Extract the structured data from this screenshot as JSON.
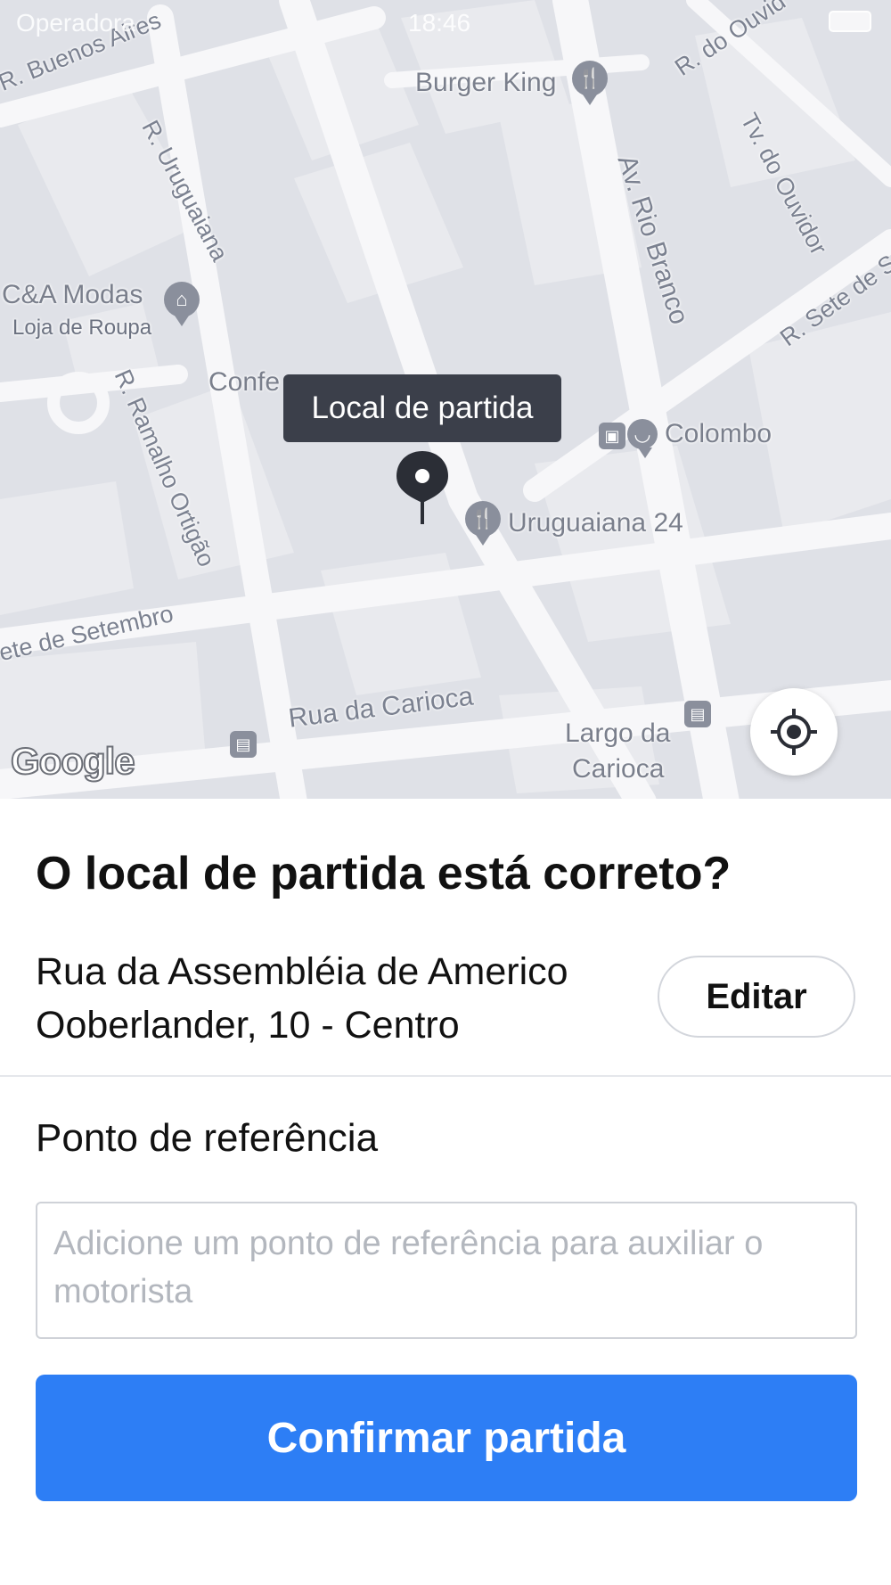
{
  "status_bar": {
    "carrier": "Operadora",
    "time": "18:46"
  },
  "map": {
    "streets": {
      "buenos_aires": "R. Buenos Aires",
      "uruguaiana": "R. Uruguaiana",
      "ramalho_ortigao": "R. Ramalho Ortigão",
      "sete_setembro_left": "ete de Setembro",
      "sete_setembro_right": "R. Sete de Se",
      "rua_da_carioca": "Rua da Carioca",
      "rio_branco": "Av. Rio Branco",
      "ouvidor": "R. do Ouvid",
      "tv_ouvidor": "Tv. do Ouvidor"
    },
    "places": {
      "burger_king": "Burger King",
      "cea": "C&A Modas",
      "cea_sub": "Loja de Roupa",
      "confeitaria": "Confe",
      "colombo": "Colombo",
      "uruguaiana24": "Uruguaiana 24",
      "largo_line1": "Largo da",
      "largo_line2": "Carioca"
    },
    "google": "Google",
    "pickup_tooltip": "Local de partida"
  },
  "sheet": {
    "title": "O local de partida está correto?",
    "address": "Rua da Assembléia de Americo Ooberlander, 10 - Centro",
    "edit_label": "Editar",
    "reference_label": "Ponto de referência",
    "reference_value": "",
    "reference_placeholder": "Adicione um ponto de referência para auxiliar o motorista",
    "confirm_label": "Confirmar partida"
  },
  "colors": {
    "accent": "#2d7ef5",
    "tooltip_bg": "#3b3f4a",
    "map_bg": "#dfe1e7"
  }
}
